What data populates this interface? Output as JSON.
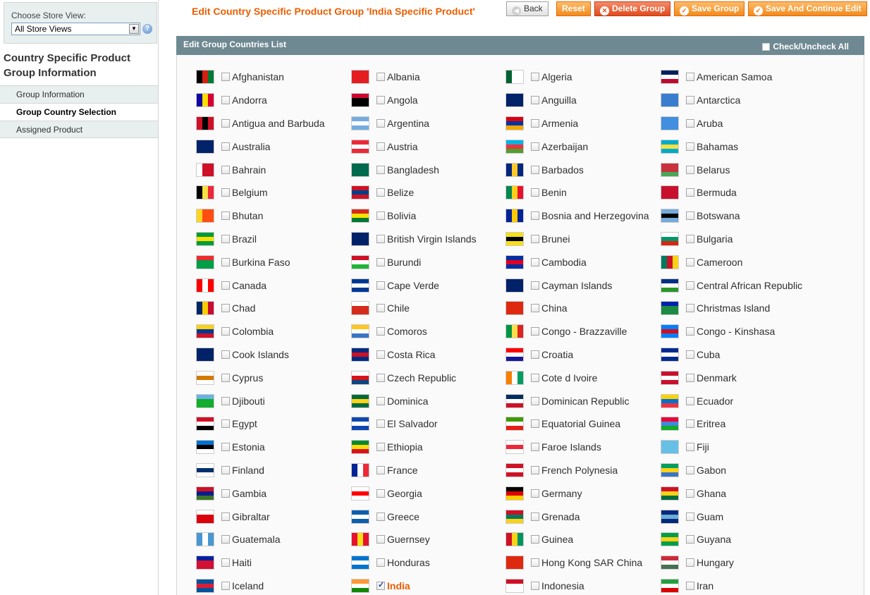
{
  "sidebar": {
    "store_label": "Choose Store View:",
    "store_value": "All Store Views",
    "title": "Country Specific Product Group Information",
    "tabs": [
      "Group Information",
      "Group Country Selection",
      "Assigned Product"
    ],
    "active_tab": 1
  },
  "header": {
    "title": "Edit Country Specific Product Group 'India Specific Product'",
    "back": "Back",
    "reset": "Reset",
    "delete": "Delete Group",
    "save": "Save Group",
    "save_continue": "Save And Continue Edit"
  },
  "panel": {
    "title": "Edit Group Countries List",
    "check_all": "Check/Uncheck All"
  },
  "countries": [
    {
      "name": "Afghanistan",
      "flag": [
        "#000000",
        "#d32011",
        "#007a36"
      ],
      "dir": "v",
      "checked": false
    },
    {
      "name": "Albania",
      "flag": [
        "#e41e20",
        "#e41e20",
        "#e41e20"
      ],
      "dir": "h",
      "checked": false
    },
    {
      "name": "Algeria",
      "flag": [
        "#006233",
        "#ffffff",
        "#ffffff"
      ],
      "dir": "v",
      "checked": false
    },
    {
      "name": "American Samoa",
      "flag": [
        "#00205b",
        "#ffffff",
        "#bf0a30"
      ],
      "dir": "h",
      "checked": false
    },
    {
      "name": "Andorra",
      "flag": [
        "#10069f",
        "#fedd00",
        "#d50032"
      ],
      "dir": "v",
      "checked": false
    },
    {
      "name": "Angola",
      "flag": [
        "#cc092f",
        "#000000",
        "#000000"
      ],
      "dir": "h",
      "checked": false
    },
    {
      "name": "Anguilla",
      "flag": [
        "#012169",
        "#012169",
        "#012169"
      ],
      "dir": "h",
      "checked": false
    },
    {
      "name": "Antarctica",
      "flag": [
        "#3a7dce",
        "#3a7dce",
        "#3a7dce"
      ],
      "dir": "h",
      "checked": false
    },
    {
      "name": "Antigua and Barbuda",
      "flag": [
        "#ce1126",
        "#000000",
        "#ce1126"
      ],
      "dir": "v",
      "checked": false
    },
    {
      "name": "Argentina",
      "flag": [
        "#74acdf",
        "#ffffff",
        "#74acdf"
      ],
      "dir": "h",
      "checked": false
    },
    {
      "name": "Armenia",
      "flag": [
        "#d90012",
        "#0033a0",
        "#f2a800"
      ],
      "dir": "h",
      "checked": false
    },
    {
      "name": "Aruba",
      "flag": [
        "#418fde",
        "#418fde",
        "#418fde"
      ],
      "dir": "h",
      "checked": false
    },
    {
      "name": "Australia",
      "flag": [
        "#012169",
        "#012169",
        "#012169"
      ],
      "dir": "h",
      "checked": false
    },
    {
      "name": "Austria",
      "flag": [
        "#ed2939",
        "#ffffff",
        "#ed2939"
      ],
      "dir": "h",
      "checked": false
    },
    {
      "name": "Azerbaijan",
      "flag": [
        "#00b5e2",
        "#ef3340",
        "#509e2f"
      ],
      "dir": "h",
      "checked": false
    },
    {
      "name": "Bahamas",
      "flag": [
        "#00abc9",
        "#fae042",
        "#00abc9"
      ],
      "dir": "h",
      "checked": false
    },
    {
      "name": "Bahrain",
      "flag": [
        "#ffffff",
        "#ce1126",
        "#ce1126"
      ],
      "dir": "v",
      "checked": false
    },
    {
      "name": "Bangladesh",
      "flag": [
        "#006a4e",
        "#006a4e",
        "#006a4e"
      ],
      "dir": "h",
      "checked": false
    },
    {
      "name": "Barbados",
      "flag": [
        "#00267f",
        "#ffc726",
        "#00267f"
      ],
      "dir": "v",
      "checked": false
    },
    {
      "name": "Belarus",
      "flag": [
        "#c8313e",
        "#c8313e",
        "#4aa657"
      ],
      "dir": "h",
      "checked": false
    },
    {
      "name": "Belgium",
      "flag": [
        "#000000",
        "#fae042",
        "#ed2939"
      ],
      "dir": "v",
      "checked": false
    },
    {
      "name": "Belize",
      "flag": [
        "#ce1126",
        "#003f87",
        "#ce1126"
      ],
      "dir": "h",
      "checked": false
    },
    {
      "name": "Benin",
      "flag": [
        "#008751",
        "#fcd116",
        "#e8112d"
      ],
      "dir": "v",
      "checked": false
    },
    {
      "name": "Bermuda",
      "flag": [
        "#c8102e",
        "#c8102e",
        "#c8102e"
      ],
      "dir": "h",
      "checked": false
    },
    {
      "name": "Bhutan",
      "flag": [
        "#ffd520",
        "#ff4e12",
        "#ff4e12"
      ],
      "dir": "v",
      "checked": false
    },
    {
      "name": "Bolivia",
      "flag": [
        "#d52b1e",
        "#f9e300",
        "#007934"
      ],
      "dir": "h",
      "checked": false
    },
    {
      "name": "Bosnia and Herzegovina",
      "flag": [
        "#002395",
        "#fecb00",
        "#002395"
      ],
      "dir": "v",
      "checked": false
    },
    {
      "name": "Botswana",
      "flag": [
        "#75aadb",
        "#000000",
        "#75aadb"
      ],
      "dir": "h",
      "checked": false
    },
    {
      "name": "Brazil",
      "flag": [
        "#009c3b",
        "#ffdf00",
        "#009c3b"
      ],
      "dir": "h",
      "checked": false
    },
    {
      "name": "British Virgin Islands",
      "flag": [
        "#012169",
        "#012169",
        "#012169"
      ],
      "dir": "h",
      "checked": false
    },
    {
      "name": "Brunei",
      "flag": [
        "#f7e017",
        "#000000",
        "#f7e017"
      ],
      "dir": "h",
      "checked": false
    },
    {
      "name": "Bulgaria",
      "flag": [
        "#ffffff",
        "#00966e",
        "#d62612"
      ],
      "dir": "h",
      "checked": false
    },
    {
      "name": "Burkina Faso",
      "flag": [
        "#ef2b2d",
        "#009e49",
        "#009e49"
      ],
      "dir": "h",
      "checked": false
    },
    {
      "name": "Burundi",
      "flag": [
        "#ce1126",
        "#ffffff",
        "#1eb53a"
      ],
      "dir": "h",
      "checked": false
    },
    {
      "name": "Cambodia",
      "flag": [
        "#032ea1",
        "#e00025",
        "#032ea1"
      ],
      "dir": "h",
      "checked": false
    },
    {
      "name": "Cameroon",
      "flag": [
        "#007a5e",
        "#ce1126",
        "#fcd116"
      ],
      "dir": "v",
      "checked": false
    },
    {
      "name": "Canada",
      "flag": [
        "#ff0000",
        "#ffffff",
        "#ff0000"
      ],
      "dir": "v",
      "checked": false
    },
    {
      "name": "Cape Verde",
      "flag": [
        "#003893",
        "#ffffff",
        "#003893"
      ],
      "dir": "h",
      "checked": false
    },
    {
      "name": "Cayman Islands",
      "flag": [
        "#012169",
        "#012169",
        "#012169"
      ],
      "dir": "h",
      "checked": false
    },
    {
      "name": "Central African Republic",
      "flag": [
        "#003082",
        "#ffffff",
        "#289728"
      ],
      "dir": "h",
      "checked": false
    },
    {
      "name": "Chad",
      "flag": [
        "#002664",
        "#fecb00",
        "#c60c30"
      ],
      "dir": "v",
      "checked": false
    },
    {
      "name": "Chile",
      "flag": [
        "#ffffff",
        "#d52b1e",
        "#d52b1e"
      ],
      "dir": "h",
      "checked": false
    },
    {
      "name": "China",
      "flag": [
        "#de2910",
        "#de2910",
        "#de2910"
      ],
      "dir": "h",
      "checked": false
    },
    {
      "name": "Christmas Island",
      "flag": [
        "#0021ad",
        "#1c8a42",
        "#1c8a42"
      ],
      "dir": "h",
      "checked": false
    },
    {
      "name": "Colombia",
      "flag": [
        "#fcd116",
        "#003893",
        "#ce1126"
      ],
      "dir": "h",
      "checked": false
    },
    {
      "name": "Comoros",
      "flag": [
        "#ffc61e",
        "#ffffff",
        "#3a75c4"
      ],
      "dir": "h",
      "checked": false
    },
    {
      "name": "Congo - Brazzaville",
      "flag": [
        "#009543",
        "#fbde4a",
        "#dc241f"
      ],
      "dir": "v",
      "checked": false
    },
    {
      "name": "Congo - Kinshasa",
      "flag": [
        "#007fff",
        "#ce1021",
        "#007fff"
      ],
      "dir": "h",
      "checked": false
    },
    {
      "name": "Cook Islands",
      "flag": [
        "#012169",
        "#012169",
        "#012169"
      ],
      "dir": "h",
      "checked": false
    },
    {
      "name": "Costa Rica",
      "flag": [
        "#002b7f",
        "#ce1126",
        "#002b7f"
      ],
      "dir": "h",
      "checked": false
    },
    {
      "name": "Croatia",
      "flag": [
        "#ff0000",
        "#ffffff",
        "#171796"
      ],
      "dir": "h",
      "checked": false
    },
    {
      "name": "Cuba",
      "flag": [
        "#002a8f",
        "#ffffff",
        "#002a8f"
      ],
      "dir": "h",
      "checked": false
    },
    {
      "name": "Cyprus",
      "flag": [
        "#ffffff",
        "#d57800",
        "#ffffff"
      ],
      "dir": "h",
      "checked": false
    },
    {
      "name": "Czech Republic",
      "flag": [
        "#ffffff",
        "#d7141a",
        "#11457e"
      ],
      "dir": "h",
      "checked": false
    },
    {
      "name": "Cote d Ivoire",
      "flag": [
        "#f77f00",
        "#ffffff",
        "#009e60"
      ],
      "dir": "v",
      "checked": false
    },
    {
      "name": "Denmark",
      "flag": [
        "#c8102e",
        "#ffffff",
        "#c8102e"
      ],
      "dir": "h",
      "checked": false
    },
    {
      "name": "Djibouti",
      "flag": [
        "#6ab2e7",
        "#12ad2b",
        "#12ad2b"
      ],
      "dir": "h",
      "checked": false
    },
    {
      "name": "Dominica",
      "flag": [
        "#006b3f",
        "#fcd116",
        "#006b3f"
      ],
      "dir": "h",
      "checked": false
    },
    {
      "name": "Dominican Republic",
      "flag": [
        "#002d62",
        "#ffffff",
        "#ce1126"
      ],
      "dir": "h",
      "checked": false
    },
    {
      "name": "Ecuador",
      "flag": [
        "#ffd100",
        "#0072ce",
        "#ef3340"
      ],
      "dir": "h",
      "checked": false
    },
    {
      "name": "Egypt",
      "flag": [
        "#ce1126",
        "#ffffff",
        "#000000"
      ],
      "dir": "h",
      "checked": false
    },
    {
      "name": "El Salvador",
      "flag": [
        "#0f47af",
        "#ffffff",
        "#0f47af"
      ],
      "dir": "h",
      "checked": false
    },
    {
      "name": "Equatorial Guinea",
      "flag": [
        "#3e9a00",
        "#ffffff",
        "#e32118"
      ],
      "dir": "h",
      "checked": false
    },
    {
      "name": "Eritrea",
      "flag": [
        "#ea0437",
        "#4189dd",
        "#12ad2b"
      ],
      "dir": "h",
      "checked": false
    },
    {
      "name": "Estonia",
      "flag": [
        "#0072ce",
        "#000000",
        "#ffffff"
      ],
      "dir": "h",
      "checked": false
    },
    {
      "name": "Ethiopia",
      "flag": [
        "#078930",
        "#fcdd09",
        "#da121a"
      ],
      "dir": "h",
      "checked": false
    },
    {
      "name": "Faroe Islands",
      "flag": [
        "#ffffff",
        "#ed2939",
        "#ffffff"
      ],
      "dir": "h",
      "checked": false
    },
    {
      "name": "Fiji",
      "flag": [
        "#68bfe5",
        "#68bfe5",
        "#68bfe5"
      ],
      "dir": "h",
      "checked": false
    },
    {
      "name": "Finland",
      "flag": [
        "#ffffff",
        "#002f6c",
        "#ffffff"
      ],
      "dir": "h",
      "checked": false
    },
    {
      "name": "France",
      "flag": [
        "#002395",
        "#ffffff",
        "#ed2939"
      ],
      "dir": "v",
      "checked": false
    },
    {
      "name": "French Polynesia",
      "flag": [
        "#ce1126",
        "#ffffff",
        "#ce1126"
      ],
      "dir": "h",
      "checked": false
    },
    {
      "name": "Gabon",
      "flag": [
        "#009e60",
        "#fcd116",
        "#3a75c4"
      ],
      "dir": "h",
      "checked": false
    },
    {
      "name": "Gambia",
      "flag": [
        "#ce1126",
        "#0c1c8c",
        "#3a7728"
      ],
      "dir": "h",
      "checked": false
    },
    {
      "name": "Georgia",
      "flag": [
        "#ffffff",
        "#ff0000",
        "#ffffff"
      ],
      "dir": "h",
      "checked": false
    },
    {
      "name": "Germany",
      "flag": [
        "#000000",
        "#dd0000",
        "#ffce00"
      ],
      "dir": "h",
      "checked": false
    },
    {
      "name": "Ghana",
      "flag": [
        "#ce1126",
        "#fcd116",
        "#006b3f"
      ],
      "dir": "h",
      "checked": false
    },
    {
      "name": "Gibraltar",
      "flag": [
        "#ffffff",
        "#da000c",
        "#da000c"
      ],
      "dir": "h",
      "checked": false
    },
    {
      "name": "Greece",
      "flag": [
        "#0d5eaf",
        "#ffffff",
        "#0d5eaf"
      ],
      "dir": "h",
      "checked": false
    },
    {
      "name": "Grenada",
      "flag": [
        "#ce1126",
        "#007a5e",
        "#fcd116"
      ],
      "dir": "h",
      "checked": false
    },
    {
      "name": "Guam",
      "flag": [
        "#00297b",
        "#6aaed6",
        "#00297b"
      ],
      "dir": "h",
      "checked": false
    },
    {
      "name": "Guatemala",
      "flag": [
        "#4997d0",
        "#ffffff",
        "#4997d0"
      ],
      "dir": "v",
      "checked": false
    },
    {
      "name": "Guernsey",
      "flag": [
        "#e8112d",
        "#f9dd16",
        "#e8112d"
      ],
      "dir": "v",
      "checked": false
    },
    {
      "name": "Guinea",
      "flag": [
        "#ce1126",
        "#fcd116",
        "#009460"
      ],
      "dir": "v",
      "checked": false
    },
    {
      "name": "Guyana",
      "flag": [
        "#009e49",
        "#fcd116",
        "#009e49"
      ],
      "dir": "h",
      "checked": false
    },
    {
      "name": "Haiti",
      "flag": [
        "#00209f",
        "#d21034",
        "#d21034"
      ],
      "dir": "h",
      "checked": false
    },
    {
      "name": "Honduras",
      "flag": [
        "#0073cf",
        "#ffffff",
        "#0073cf"
      ],
      "dir": "h",
      "checked": false
    },
    {
      "name": "Hong Kong SAR China",
      "flag": [
        "#de2910",
        "#de2910",
        "#de2910"
      ],
      "dir": "h",
      "checked": false
    },
    {
      "name": "Hungary",
      "flag": [
        "#ce2939",
        "#ffffff",
        "#477050"
      ],
      "dir": "h",
      "checked": false
    },
    {
      "name": "Iceland",
      "flag": [
        "#02529c",
        "#dc1e35",
        "#02529c"
      ],
      "dir": "h",
      "checked": false
    },
    {
      "name": "India",
      "flag": [
        "#ff9933",
        "#ffffff",
        "#138808"
      ],
      "dir": "h",
      "checked": true
    },
    {
      "name": "Indonesia",
      "flag": [
        "#ce1126",
        "#ffffff",
        "#ffffff"
      ],
      "dir": "h",
      "checked": false
    },
    {
      "name": "Iran",
      "flag": [
        "#239f40",
        "#ffffff",
        "#da0000"
      ],
      "dir": "h",
      "checked": false
    }
  ]
}
